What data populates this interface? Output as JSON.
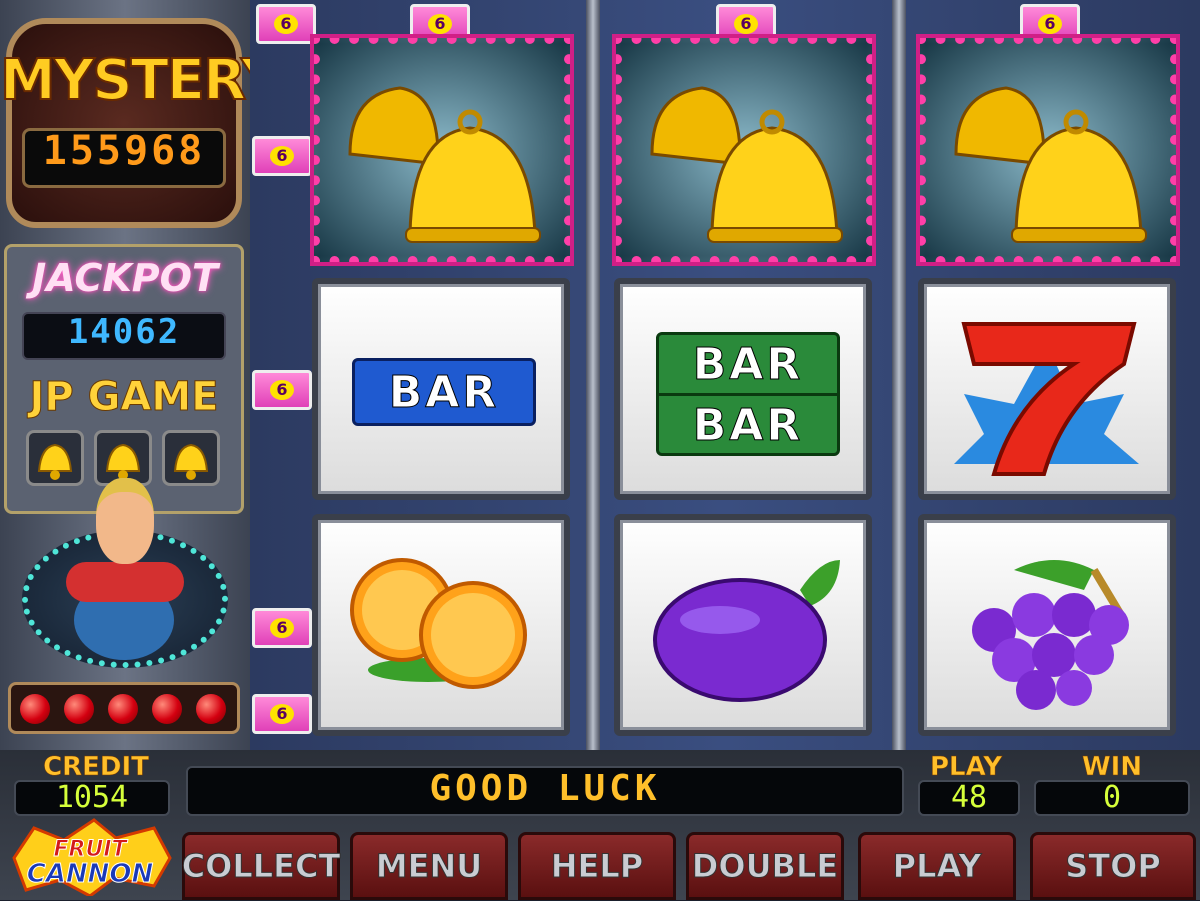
{
  "mystery": {
    "title": "MYSTERY",
    "value": "155968"
  },
  "jackpot": {
    "title": "JACKPOT",
    "value": "14062",
    "jp_game_label": "JP GAME"
  },
  "line_badges": [
    "6",
    "6",
    "6",
    "6",
    "6",
    "6",
    "6"
  ],
  "reels": [
    {
      "top": "bell",
      "middle": "BAR",
      "bottom": "orange"
    },
    {
      "top": "bell",
      "middle_lines": [
        "BAR",
        "BAR"
      ],
      "bottom": "plum"
    },
    {
      "top": "bell",
      "middle": "seven",
      "bottom": "grapes"
    }
  ],
  "status": {
    "credit_label": "CREDIT",
    "credit_value": "1054",
    "message": "GOOD LUCK",
    "play_label": "PLAY",
    "play_value": "48",
    "win_label": "WIN",
    "win_value": "0"
  },
  "logo": {
    "line1": "FRUIT",
    "line2": "CANNON"
  },
  "buttons": {
    "collect": "COLLECT",
    "menu": "MENU",
    "help": "HELP",
    "double": "DOUBLE",
    "play": "PLAY",
    "stop": "STOP"
  },
  "colors": {
    "accent_pink": "#ff3fa8",
    "digit_orange": "#ff9a1a",
    "digit_blue": "#3fb8ff",
    "digit_green": "#d6ff3a"
  }
}
